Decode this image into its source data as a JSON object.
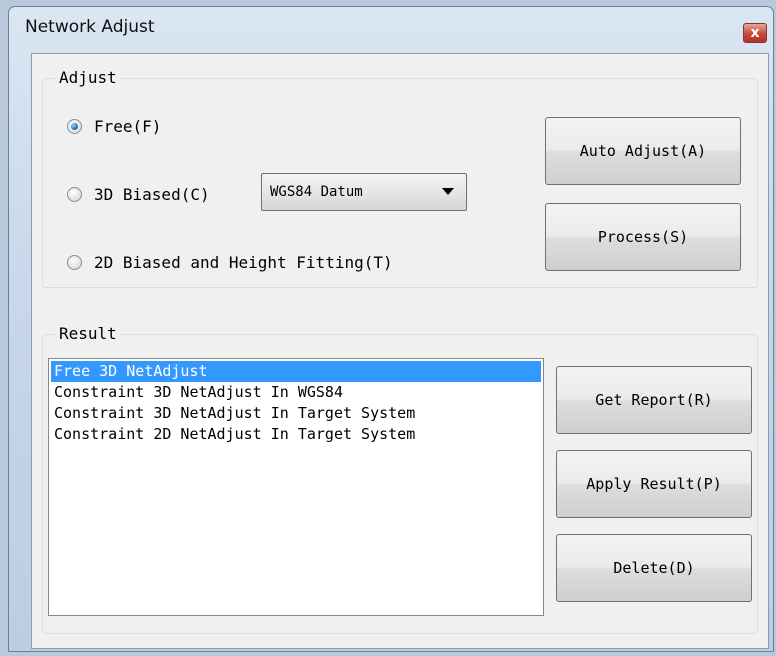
{
  "window": {
    "title": "Network Adjust",
    "close_label": "x"
  },
  "adjust": {
    "group_title": "Adjust",
    "options": [
      {
        "label": "Free(F)",
        "checked": true
      },
      {
        "label": "3D Biased(C)",
        "checked": false
      },
      {
        "label": "2D Biased and Height Fitting(T)",
        "checked": false
      }
    ],
    "datum_select": {
      "value": "WGS84 Datum"
    },
    "buttons": {
      "auto_adjust": "Auto Adjust(A)",
      "process": "Process(S)"
    }
  },
  "result": {
    "group_title": "Result",
    "items": [
      {
        "label": "Free 3D NetAdjust",
        "selected": true
      },
      {
        "label": "Constraint 3D NetAdjust In WGS84",
        "selected": false
      },
      {
        "label": "Constraint 3D NetAdjust In Target System",
        "selected": false
      },
      {
        "label": "Constraint 2D NetAdjust In Target System",
        "selected": false
      }
    ],
    "buttons": {
      "get_report": "Get Report(R)",
      "apply_result": "Apply Result(P)",
      "delete": "Delete(D)"
    }
  },
  "colors": {
    "selection": "#3399ff",
    "dialog_bg": "#f0f0f0",
    "close_button": "#c9463a"
  }
}
